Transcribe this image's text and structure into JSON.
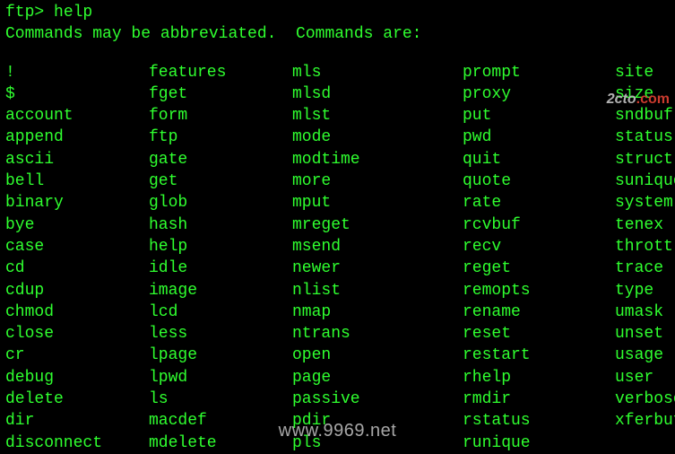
{
  "prompt": "ftp> ",
  "entered_command": "help",
  "header_text": "Commands may be abbreviated.  Commands are:",
  "commands": {
    "col1": [
      "!",
      "$",
      "account",
      "append",
      "ascii",
      "bell",
      "binary",
      "bye",
      "case",
      "cd",
      "cdup",
      "chmod",
      "close",
      "cr",
      "debug",
      "delete",
      "dir",
      "disconnect"
    ],
    "col2": [
      "features",
      "fget",
      "form",
      "ftp",
      "gate",
      "get",
      "glob",
      "hash",
      "help",
      "idle",
      "image",
      "lcd",
      "less",
      "lpage",
      "lpwd",
      "ls",
      "macdef",
      "mdelete"
    ],
    "col3": [
      "mls",
      "mlsd",
      "mlst",
      "mode",
      "modtime",
      "more",
      "mput",
      "mreget",
      "msend",
      "newer",
      "nlist",
      "nmap",
      "ntrans",
      "open",
      "page",
      "passive",
      "pdir",
      "pls"
    ],
    "col4": [
      "prompt",
      "proxy",
      "put",
      "pwd",
      "quit",
      "quote",
      "rate",
      "rcvbuf",
      "recv",
      "reget",
      "remopts",
      "rename",
      "reset",
      "restart",
      "rhelp",
      "rmdir",
      "rstatus",
      "runique"
    ],
    "col5": [
      "site",
      "size",
      "sndbuf",
      "status",
      "struct",
      "sunique",
      "system",
      "tenex",
      "throttle",
      "trace",
      "type",
      "umask",
      "unset",
      "usage",
      "user",
      "verbose",
      "xferbuf"
    ]
  },
  "watermark": "www.9969.net",
  "badge_prefix": "2cto",
  "badge_suffix": ".com"
}
